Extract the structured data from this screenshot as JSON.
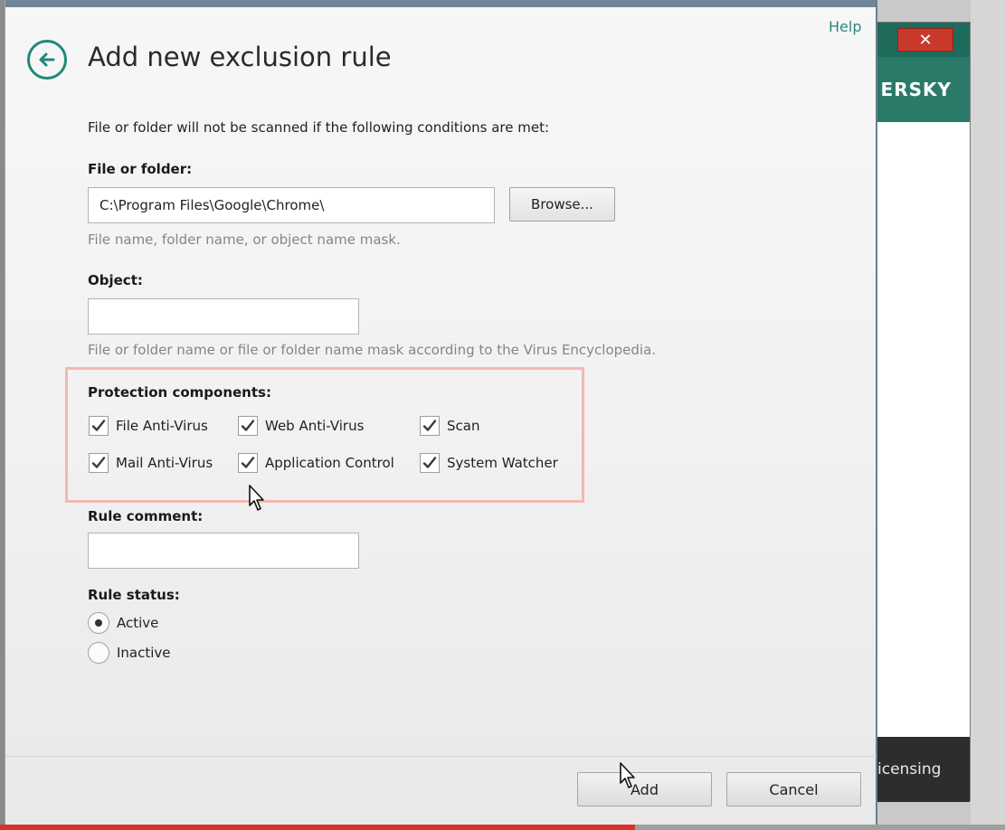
{
  "background_app": {
    "brand_fragment": "ERSKY",
    "close_glyph": "✕",
    "footer_label": "icensing"
  },
  "dialog": {
    "help_label": "Help",
    "title": "Add new exclusion rule",
    "back_icon": "back-arrow-circle-icon",
    "intro_text": "File or folder will not be scanned if the following conditions are met:",
    "file_or_folder": {
      "label": "File or folder:",
      "value": "C:\\Program Files\\Google\\Chrome\\",
      "browse_label": "Browse...",
      "hint": "File name, folder name, or object name mask."
    },
    "object": {
      "label": "Object:",
      "value": "",
      "hint": "File or folder name or file or folder name mask according to the Virus Encyclopedia."
    },
    "protection_components": {
      "label": "Protection components:",
      "items": [
        {
          "label": "File Anti-Virus",
          "checked": true
        },
        {
          "label": "Web Anti-Virus",
          "checked": true
        },
        {
          "label": "Scan",
          "checked": true
        },
        {
          "label": "Mail Anti-Virus",
          "checked": true
        },
        {
          "label": "Application Control",
          "checked": true
        },
        {
          "label": "System Watcher",
          "checked": true
        }
      ]
    },
    "rule_comment": {
      "label": "Rule comment:",
      "value": ""
    },
    "rule_status": {
      "label": "Rule status:",
      "options": [
        {
          "label": "Active",
          "selected": true
        },
        {
          "label": "Inactive",
          "selected": false
        }
      ]
    },
    "buttons": {
      "add": "Add",
      "cancel": "Cancel"
    }
  },
  "colors": {
    "accent": "#1f8a77",
    "highlight_border": "#f6b7b0"
  }
}
